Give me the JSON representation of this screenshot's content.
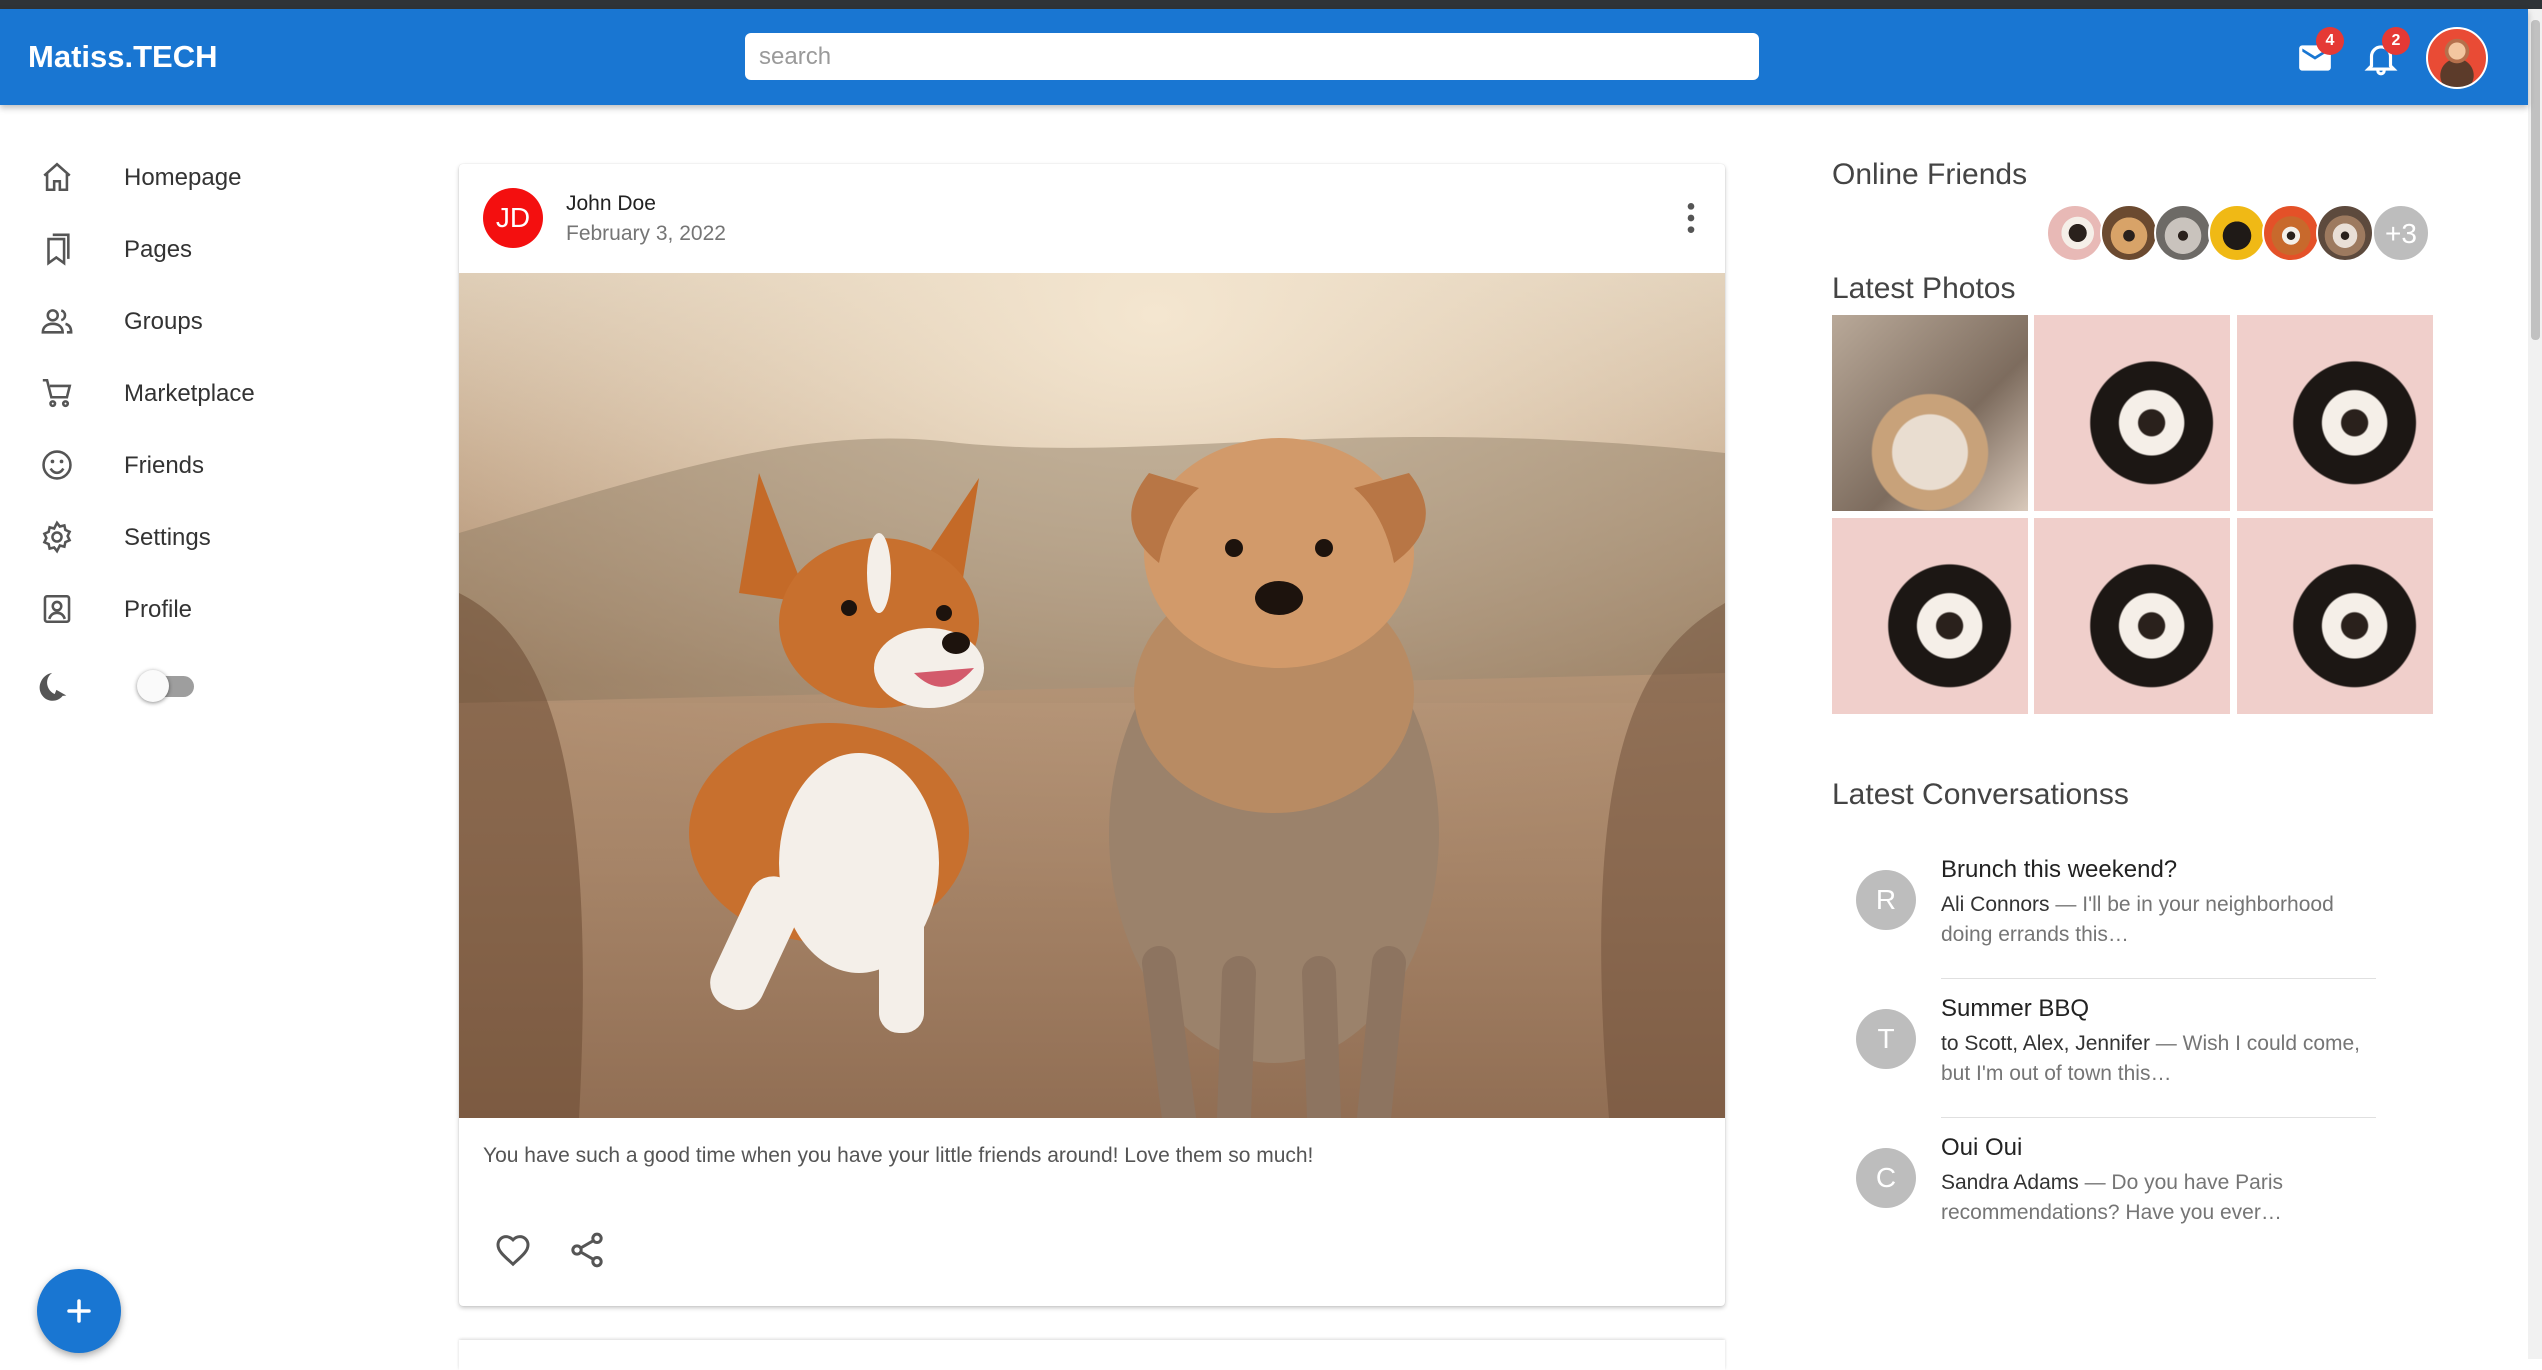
{
  "header": {
    "logo": "Matiss.TECH",
    "search_placeholder": "search",
    "mail_count": "4",
    "notification_count": "2"
  },
  "sidebar": {
    "items": [
      {
        "label": "Homepage",
        "icon": "home-icon"
      },
      {
        "label": "Pages",
        "icon": "bookmarks-icon"
      },
      {
        "label": "Groups",
        "icon": "groups-icon"
      },
      {
        "label": "Marketplace",
        "icon": "cart-icon"
      },
      {
        "label": "Friends",
        "icon": "smiley-icon"
      },
      {
        "label": "Settings",
        "icon": "gear-icon"
      },
      {
        "label": "Profile",
        "icon": "profile-icon"
      }
    ],
    "dark_mode_enabled": false
  },
  "post": {
    "avatar_initials": "JD",
    "author": "John Doe",
    "date": "February 3, 2022",
    "text": "You have such a good time when you have your little friends around! Love them so much!"
  },
  "right_panel": {
    "online_friends_title": "Online Friends",
    "online_friends_more": "+3",
    "latest_photos_title": "Latest Photos",
    "latest_conversations_title": "Latest Conversationss",
    "conversations": [
      {
        "initial": "R",
        "title": "Brunch this weekend?",
        "from": "Ali Connors",
        "snippet": " — I'll be in your neighborhood doing errands this…"
      },
      {
        "initial": "T",
        "title": "Summer BBQ",
        "from": "to Scott, Alex, Jennifer",
        "snippet": " — Wish I could come, but I'm out of town this…"
      },
      {
        "initial": "C",
        "title": "Oui Oui",
        "from": "Sandra Adams",
        "snippet": " — Do you have Paris recommendations? Have you ever…"
      }
    ]
  },
  "colors": {
    "appbar": "#1976d2",
    "badge": "#e53935",
    "post_avatar": "#f40f0f"
  }
}
